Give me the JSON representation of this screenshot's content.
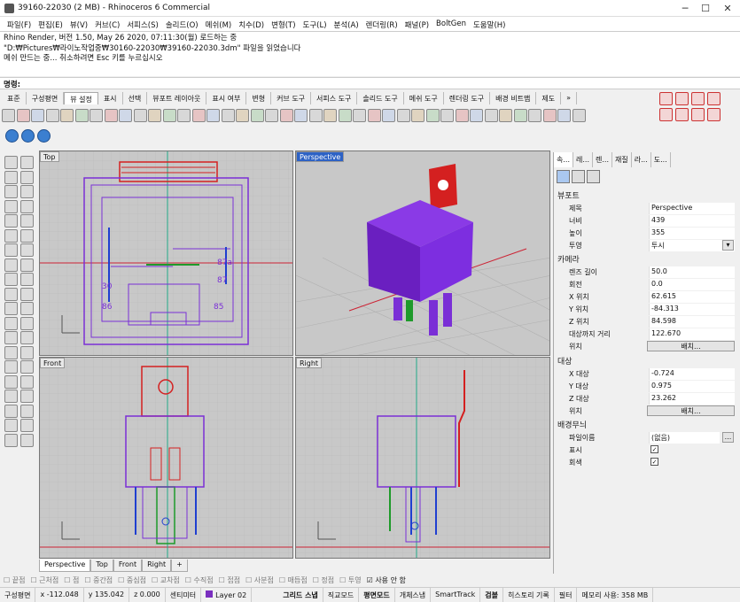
{
  "window": {
    "title": "39160-22030 (2 MB) - Rhinoceros 6 Commercial",
    "controls": [
      "─",
      "☐",
      "✕"
    ]
  },
  "menu": [
    "파일(F)",
    "편집(E)",
    "뷰(V)",
    "커브(C)",
    "서피스(S)",
    "솔리드(O)",
    "메쉬(M)",
    "치수(D)",
    "변형(T)",
    "도구(L)",
    "분석(A)",
    "렌더링(R)",
    "패널(P)",
    "BoltGen",
    "도움말(H)"
  ],
  "history": [
    "Rhino Render, 버전 1.50, May 26 2020, 07:11:30(월) 로드하는 중",
    "\"D:₩Pictures₩라이노작업중₩30160-22030₩39160-22030.3dm\" 파일을 읽었습니다",
    "메쉬 만드는 중... 취소하려면 Esc 키를 누르십시오"
  ],
  "command": {
    "label": "명령:"
  },
  "tabs": [
    "표준",
    "구성평면",
    "뷰 설정",
    "표시",
    "선택",
    "뷰포트 레이아웃",
    "표시 여부",
    "변형",
    "커브 도구",
    "서피스 도구",
    "솔리드 도구",
    "메쉬 도구",
    "렌더링 도구",
    "배경 비트맵",
    "제도",
    "»"
  ],
  "active_tab": "뷰 설정",
  "viewports": {
    "top": "Top",
    "perspective": "Perspective",
    "front": "Front",
    "right": "Right",
    "top_labels": [
      "87a",
      "87",
      "30",
      "86",
      "85"
    ]
  },
  "viewport_tabs": [
    "Perspective",
    "Top",
    "Front",
    "Right",
    "+"
  ],
  "panel": {
    "tabs": [
      "속...",
      "레...",
      "렌...",
      "재질",
      "라...",
      "도..."
    ],
    "viewport_section": "뷰포트",
    "viewport_rows": [
      {
        "k": "제목",
        "v": "Perspective"
      },
      {
        "k": "너비",
        "v": "439"
      },
      {
        "k": "높이",
        "v": "355"
      },
      {
        "k": "투영",
        "v": "투시"
      }
    ],
    "camera_section": "카메라",
    "camera_rows": [
      {
        "k": "렌즈 길이",
        "v": "50.0"
      },
      {
        "k": "회전",
        "v": "0.0"
      },
      {
        "k": "X 위치",
        "v": "62.615"
      },
      {
        "k": "Y 위치",
        "v": "-84.313"
      },
      {
        "k": "Z 위치",
        "v": "84.598"
      },
      {
        "k": "대상까지 거리",
        "v": "122.670"
      }
    ],
    "position_label": "위치",
    "place_button": "배치...",
    "target_section": "대상",
    "target_rows": [
      {
        "k": "X 대상",
        "v": "-0.724"
      },
      {
        "k": "Y 대상",
        "v": "0.975"
      },
      {
        "k": "Z 대상",
        "v": "23.262"
      }
    ],
    "bg_section": "배경무늬",
    "bg_filename_label": "파일이름",
    "bg_filename_value": "(없음)",
    "bg_show_label": "표시",
    "bg_gray_label": "회색",
    "browse_button": "..."
  },
  "osnap": [
    {
      "label": "끝점",
      "on": false
    },
    {
      "label": "근처점",
      "on": false
    },
    {
      "label": "점",
      "on": false
    },
    {
      "label": "중간점",
      "on": false
    },
    {
      "label": "중심점",
      "on": false
    },
    {
      "label": "교차점",
      "on": false
    },
    {
      "label": "수직점",
      "on": false
    },
    {
      "label": "접점",
      "on": false
    },
    {
      "label": "사분점",
      "on": false
    },
    {
      "label": "매듭점",
      "on": false
    },
    {
      "label": "정점",
      "on": false
    },
    {
      "label": "투영",
      "on": false
    },
    {
      "label": "사용 안 함",
      "on": true
    }
  ],
  "status": {
    "cplane": "구성평면",
    "x": "x -112.048",
    "y": "y 135.042",
    "z": "z 0.000",
    "units": "센티미터",
    "layer": "Layer 02",
    "layer_color": "#7a2fbf",
    "grid_snap": "그리드 스냅",
    "ortho": "직교모드",
    "planar": "평면모드",
    "osnap": "개체스냅",
    "smarttrack": "SmartTrack",
    "gumball": "검볼",
    "history": "히스토리 기록",
    "filter": "필터",
    "memory": "메모리 사용: 358 MB"
  },
  "colors": {
    "purple": "#7a2fd6",
    "red": "#d42020",
    "blue": "#1f3fd0",
    "green": "#1e9a2a",
    "active_vp": "#2d62c5"
  }
}
